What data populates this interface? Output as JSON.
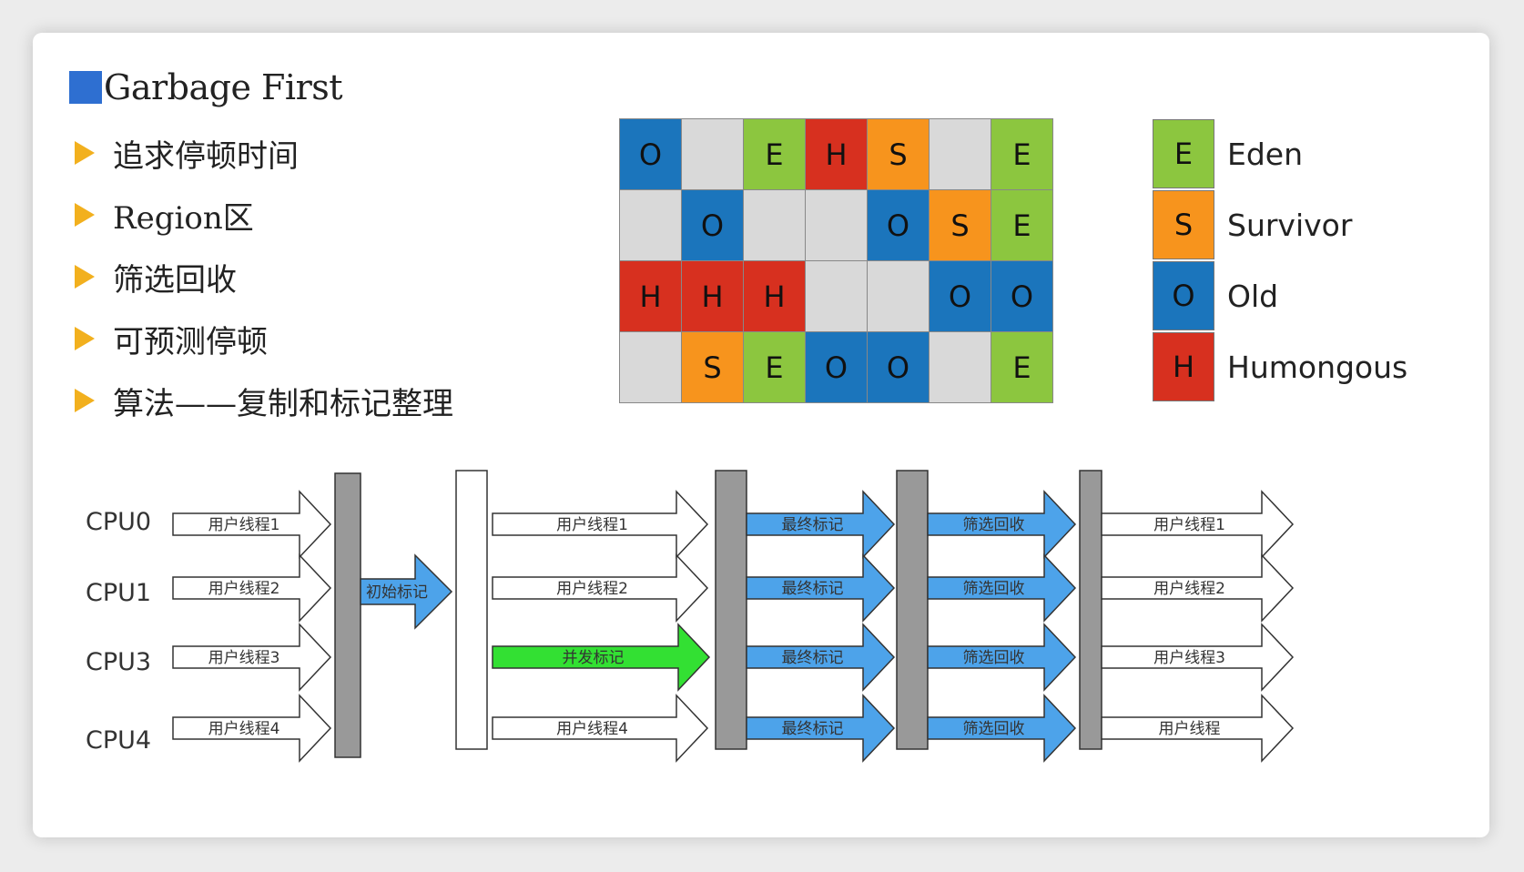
{
  "title": "Garbage First",
  "bullets": [
    "追求停顿时间",
    "Region区",
    "筛选回收",
    "可预测停顿",
    "算法——复制和标记整理"
  ],
  "colors": {
    "E": "#8cc63f",
    "S": "#f7941d",
    "O": "#1b75bc",
    "H": "#d7301f",
    "empty": "#d9d9d9",
    "accent": "#2e6fd1",
    "bullet": "#f2b01e",
    "blue_arrow": "#4da3ea",
    "green_arrow": "#33e033",
    "bar": "#999999"
  },
  "region_grid": [
    [
      "O",
      "",
      "E",
      "H",
      "S",
      "",
      "E"
    ],
    [
      "",
      "O",
      "",
      "",
      "O",
      "S",
      "E"
    ],
    [
      "H",
      "H",
      "H",
      "",
      "",
      "O",
      "O"
    ],
    [
      "",
      "S",
      "E",
      "O",
      "O",
      "",
      "E"
    ]
  ],
  "legend": [
    {
      "key": "E",
      "label": "Eden"
    },
    {
      "key": "S",
      "label": "Survivor"
    },
    {
      "key": "O",
      "label": "Old"
    },
    {
      "key": "H",
      "label": "Humongous"
    }
  ],
  "timeline": {
    "cpus": [
      "CPU0",
      "CPU1",
      "CPU3",
      "CPU4"
    ],
    "phase1": [
      "用户线程1",
      "用户线程2",
      "用户线程3",
      "用户线程4"
    ],
    "initial_mark": "初始标记",
    "phase2": [
      "用户线程1",
      "用户线程2",
      "并发标记",
      "用户线程4"
    ],
    "final_mark": [
      "最终标记",
      "最终标记",
      "最终标记",
      "最终标记"
    ],
    "cleanup": [
      "筛选回收",
      "筛选回收",
      "筛选回收",
      "筛选回收"
    ],
    "phase3": [
      "用户线程1",
      "用户线程2",
      "用户线程3",
      "用户线程"
    ]
  }
}
